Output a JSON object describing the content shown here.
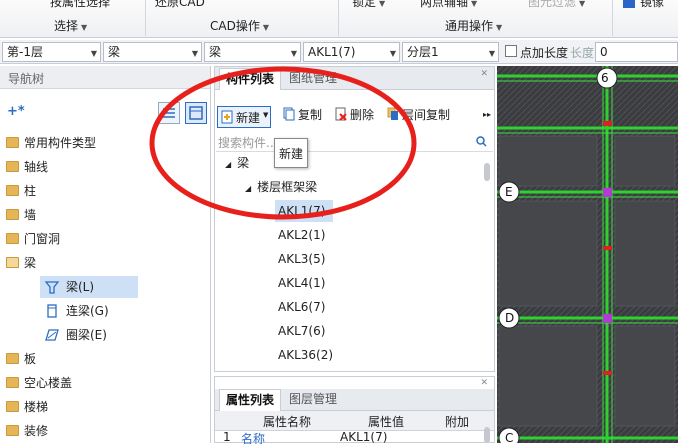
{
  "ribbon": {
    "top_buttons": [
      "按属性选择",
      "还原CAD",
      "锁定",
      "两点辅轴",
      "图元过滤",
      "镜像"
    ],
    "groups": [
      "选择",
      "CAD操作",
      "通用操作"
    ]
  },
  "selectors": {
    "floor": "第-1层",
    "category": "梁",
    "type": "梁",
    "component": "AKL1(7)",
    "layer": "分层1",
    "checkbox_label": "点加长度",
    "length_label": "长度:",
    "length_value": "0"
  },
  "nav": {
    "title": "导航树",
    "items": [
      "常用构件类型",
      "轴线",
      "柱",
      "墙",
      "门窗洞",
      "梁",
      "板",
      "空心楼盖",
      "楼梯",
      "装修"
    ],
    "beam_children": [
      "梁(L)",
      "连梁(G)",
      "圈梁(E)"
    ]
  },
  "component_panel": {
    "tabs": [
      "构件列表",
      "图纸管理"
    ],
    "toolbar": [
      "新建",
      "复制",
      "删除",
      "层间复制"
    ],
    "search_placeholder": "搜索构件...",
    "tooltip": "新建",
    "tree_root": "梁",
    "tree_group": "楼层框架梁",
    "items": [
      "AKL1(7)",
      "AKL2(1)",
      "AKL3(5)",
      "AKL4(1)",
      "AKL6(7)",
      "AKL7(6)",
      "AKL36(2)"
    ],
    "selected": "AKL1(7)"
  },
  "properties_panel": {
    "tabs": [
      "属性列表",
      "图层管理"
    ],
    "columns": [
      "属性名称",
      "属性值",
      "附加"
    ],
    "rows": [
      {
        "index": "1",
        "name": "名称",
        "value": "AKL1(7)"
      }
    ]
  },
  "drawing": {
    "axis_labels": [
      "6",
      "E",
      "D",
      "C"
    ]
  },
  "colors": {
    "annotation_circle": "#e8201c",
    "beam_green": "#2fd12f",
    "canvas_bg": "#2e3033",
    "selection": "#cde0f5"
  }
}
